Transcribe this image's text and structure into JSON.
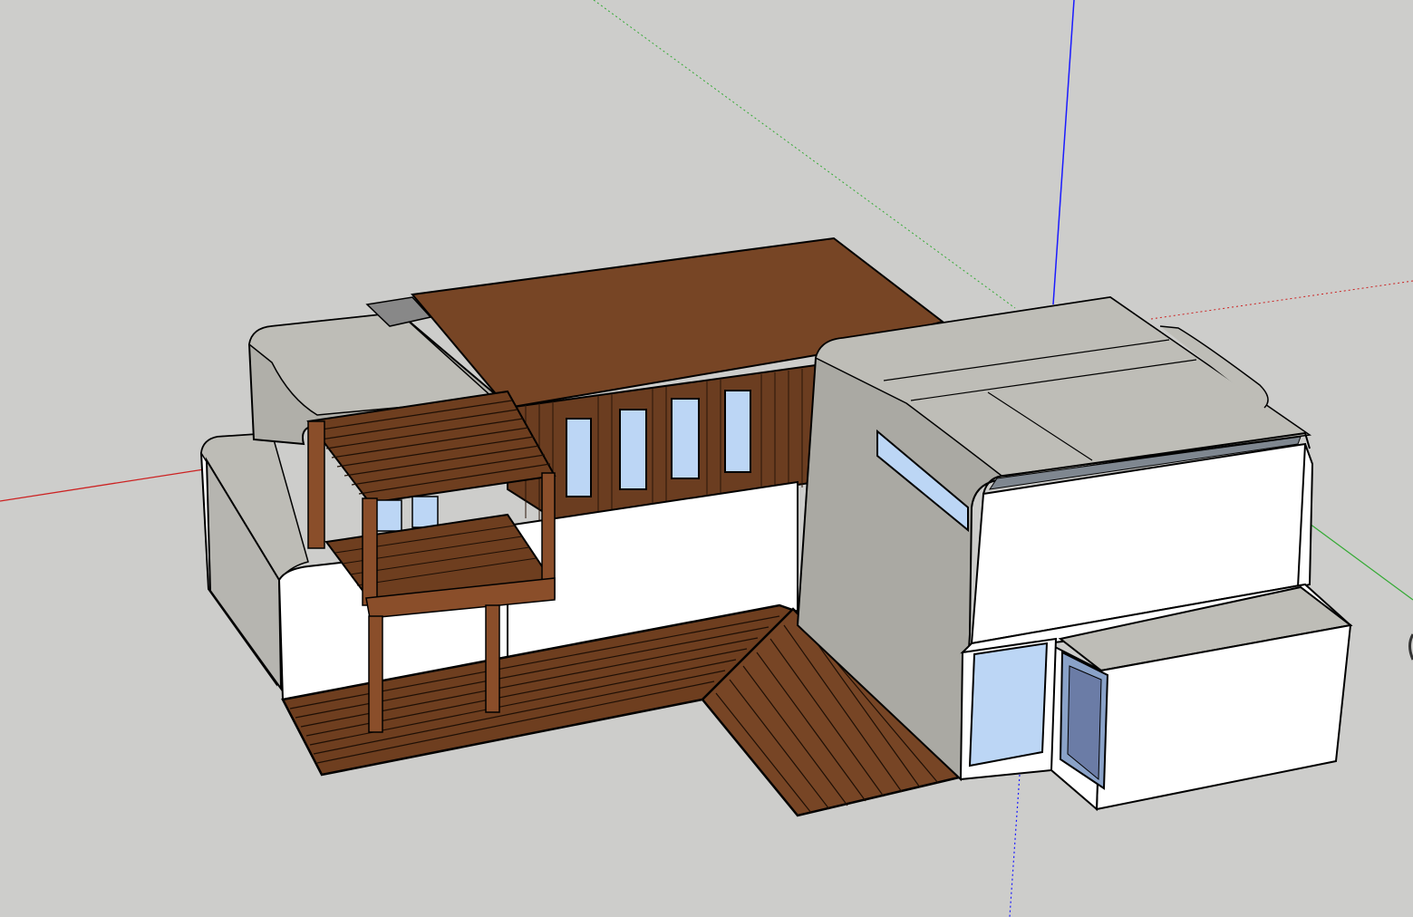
{
  "app": {
    "viewport_label": ""
  },
  "scene": {
    "model_name": "",
    "axis_colors": {
      "red": "#cc2222",
      "green": "#33aa33",
      "blue": "#1a1aff"
    },
    "material_colors": {
      "wood": "#774525",
      "wood_dark": "#5e3418",
      "wall_white": "#ffffff",
      "wall_grey": "#aaa9a3",
      "roof_grey": "#bdbcb6",
      "glass": "#bcd6f5",
      "ground": "#cdcdcb"
    }
  }
}
